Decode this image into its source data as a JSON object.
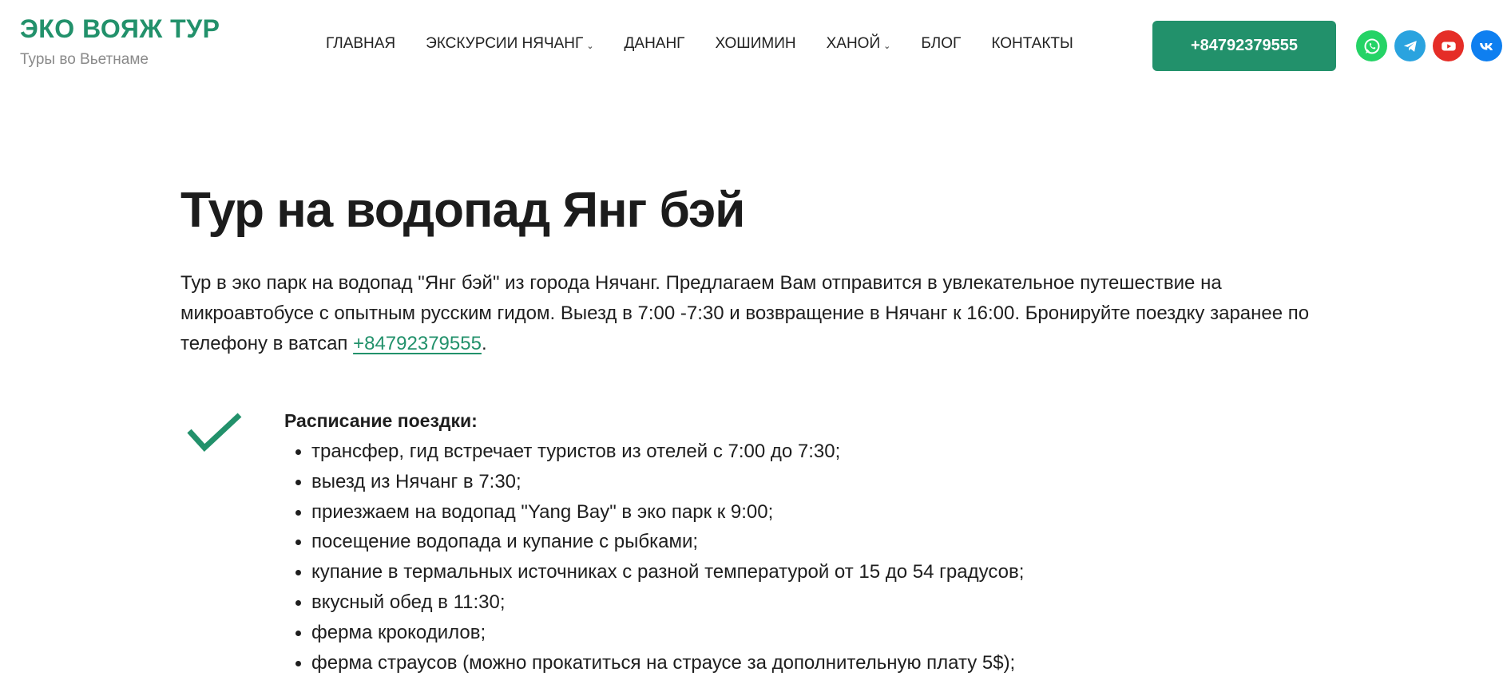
{
  "header": {
    "logo_title": "ЭКО ВОЯЖ ТУР",
    "logo_subtitle": "Туры во Вьетнаме",
    "nav": [
      {
        "label": "ГЛАВНАЯ",
        "has_dropdown": false
      },
      {
        "label": "ЭКСКУРСИИ НЯЧАНГ",
        "has_dropdown": true
      },
      {
        "label": "ДАНАНГ",
        "has_dropdown": false
      },
      {
        "label": "ХОШИМИН",
        "has_dropdown": false
      },
      {
        "label": "ХАНОЙ",
        "has_dropdown": true
      },
      {
        "label": "БЛОГ",
        "has_dropdown": false
      },
      {
        "label": "КОНТАКТЫ",
        "has_dropdown": false
      }
    ],
    "phone_button": "+84792379555",
    "socials": [
      {
        "icon": "whatsapp-icon",
        "color": "#25d366"
      },
      {
        "icon": "telegram-icon",
        "color": "#2aa3df"
      },
      {
        "icon": "youtube-icon",
        "color": "#e52d27"
      },
      {
        "icon": "vk-icon",
        "color": "#0e7ff0"
      }
    ]
  },
  "main": {
    "title": "Тур на водопад Янг бэй",
    "intro_text": "Тур в эко парк на водопад \"Янг бэй\" из города Нячанг. Предлагаем Вам отправится в увлекательное путешествие на микроавтобусе с опытным русским гидом. Выезд в 7:00 -7:30 и возвращение в Нячанг к 16:00. Бронируйте поездку заранее по телефону в ватсап ",
    "intro_link": "+84792379555",
    "intro_end": ".",
    "schedule": {
      "title": "Расписание поездки:",
      "items": [
        "трансфер, гид встречает туристов из отелей с 7:00 до 7:30;",
        "выезд из Нячанг в 7:30;",
        "приезжаем на водопад \"Yang Bay\" в эко парк к 9:00;",
        "посещение водопада и купание с рыбками;",
        "купание в термальных источниках с разной температурой от 15 до 54 градусов;",
        "вкусный обед в 11:30;",
        "ферма крокодилов;",
        "ферма страусов (можно прокатиться на страусе за дополнительную плату 5$);"
      ]
    }
  },
  "colors": {
    "accent": "#22916b",
    "text": "#1e1e1e",
    "muted": "#8a8a8a"
  }
}
